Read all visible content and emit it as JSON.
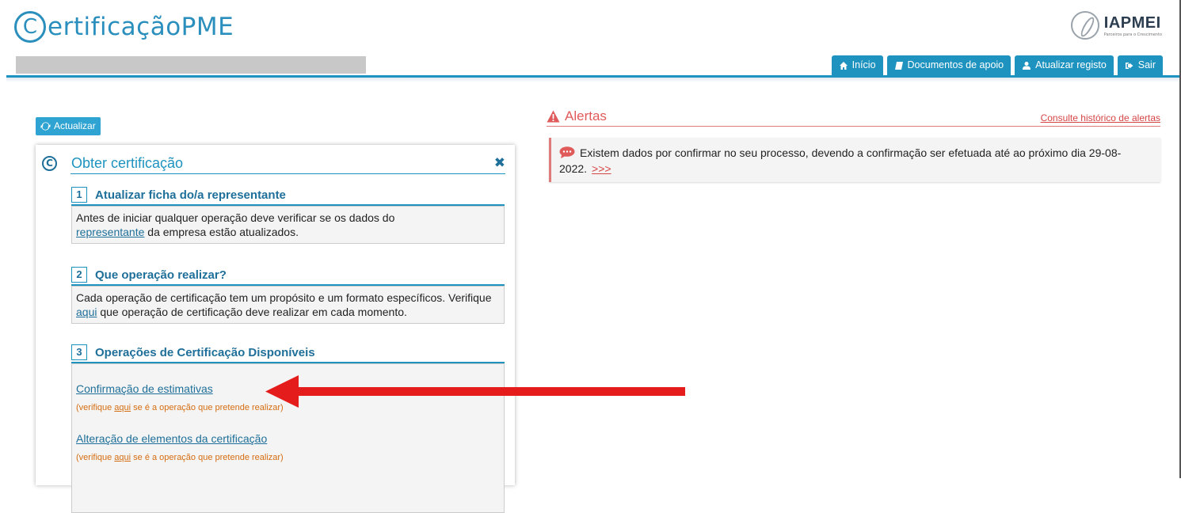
{
  "header": {
    "logo_prefix": "ertificação",
    "logo_suffix": "PME",
    "logo_c": "C",
    "partner_name": "IAPMEI",
    "partner_tagline": "Parceiros para o Crescimento"
  },
  "nav": [
    {
      "label": "Início",
      "icon": "home-icon"
    },
    {
      "label": "Documentos de apoio",
      "icon": "book-icon"
    },
    {
      "label": "Atualizar registo",
      "icon": "user-icon"
    },
    {
      "label": "Sair",
      "icon": "sign-out-icon"
    }
  ],
  "refresh_label": "Actualizar",
  "panel": {
    "title": "Obter certificação",
    "close": "✖",
    "steps": [
      {
        "num": "1",
        "title": "Atualizar ficha do/a representante",
        "text_before": "Antes de iniciar qualquer operação deve verificar se os dados do",
        "link": "representante",
        "text_after": " da empresa estão atualizados."
      },
      {
        "num": "2",
        "title": "Que operação realizar?",
        "text_before": "Cada operação de certificação tem um propósito e um formato específicos. Verifique ",
        "link": "aqui",
        "text_after": " que operação de certificação deve realizar em cada momento."
      },
      {
        "num": "3",
        "title": "Operações de Certificação Disponíveis"
      }
    ],
    "operations": [
      {
        "label": "Confirmação de estimativas",
        "note_before": "(verifique ",
        "note_link": "aqui",
        "note_after": " se é a operação que pretende realizar)"
      },
      {
        "label": "Alteração de elementos da certificação",
        "note_before": "(verifique ",
        "note_link": "aqui",
        "note_after": " se é a operação que pretende realizar)"
      }
    ]
  },
  "alerts": {
    "title": "Alertas",
    "history_link": "Consulte histórico de alertas",
    "message": "Existem dados por confirmar no seu processo, devendo a confirmação ser efetuada até ao próximo dia 29-08-2022.",
    "more_link": ">>>"
  },
  "colors": {
    "accent": "#1e93bf",
    "alert": "#e05a5a",
    "note": "#d56d12",
    "arrow": "#e41c1c"
  }
}
